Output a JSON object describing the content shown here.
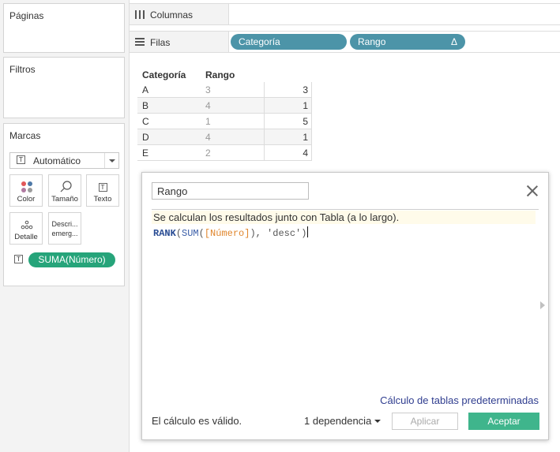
{
  "left_panel": {
    "pages_title": "Páginas",
    "filters_title": "Filtros",
    "marks_title": "Marcas",
    "mark_type": "Automático",
    "mark_buttons": {
      "color": "Color",
      "size": "Tamaño",
      "label": "Texto",
      "detail": "Detalle",
      "tooltip_line1": "Descri...",
      "tooltip_line2": "emerg..."
    },
    "text_field_pill": "SUMA(Número)",
    "icon_glyph": "T"
  },
  "shelves": {
    "columns_label": "Columnas",
    "rows_label": "Filas",
    "rows_pills": [
      "Categoría",
      "Rango"
    ],
    "delta_symbol": "Δ"
  },
  "table": {
    "headers": [
      "Categoría",
      "Rango"
    ],
    "rows": [
      {
        "cat": "A",
        "rank": "3",
        "value": "3"
      },
      {
        "cat": "B",
        "rank": "4",
        "value": "1"
      },
      {
        "cat": "C",
        "rank": "1",
        "value": "5"
      },
      {
        "cat": "D",
        "rank": "4",
        "value": "1"
      },
      {
        "cat": "E",
        "rank": "2",
        "value": "4"
      }
    ]
  },
  "calc_dialog": {
    "name": "Rango",
    "info": "Se calculan los resultados junto con Tabla (a lo largo).",
    "formula": {
      "fn1": "RANK",
      "p1": "(",
      "fn2": "SUM",
      "p2": "(",
      "field": "[Número]",
      "p3": "), ",
      "str": "'desc'",
      "p4": ")"
    },
    "default_link": "Cálculo de tablas predeterminadas",
    "status": "El cálculo es válido.",
    "dependencies": "1 dependencia",
    "apply_label": "Aplicar",
    "ok_label": "Aceptar"
  },
  "colors": {
    "pill_dimension": "#4c94a8",
    "pill_measure": "#26a47a",
    "ok_button": "#3fb58c",
    "link": "#2f3d8f",
    "formula_function": "#2a4d94",
    "formula_field": "#e0862d"
  }
}
